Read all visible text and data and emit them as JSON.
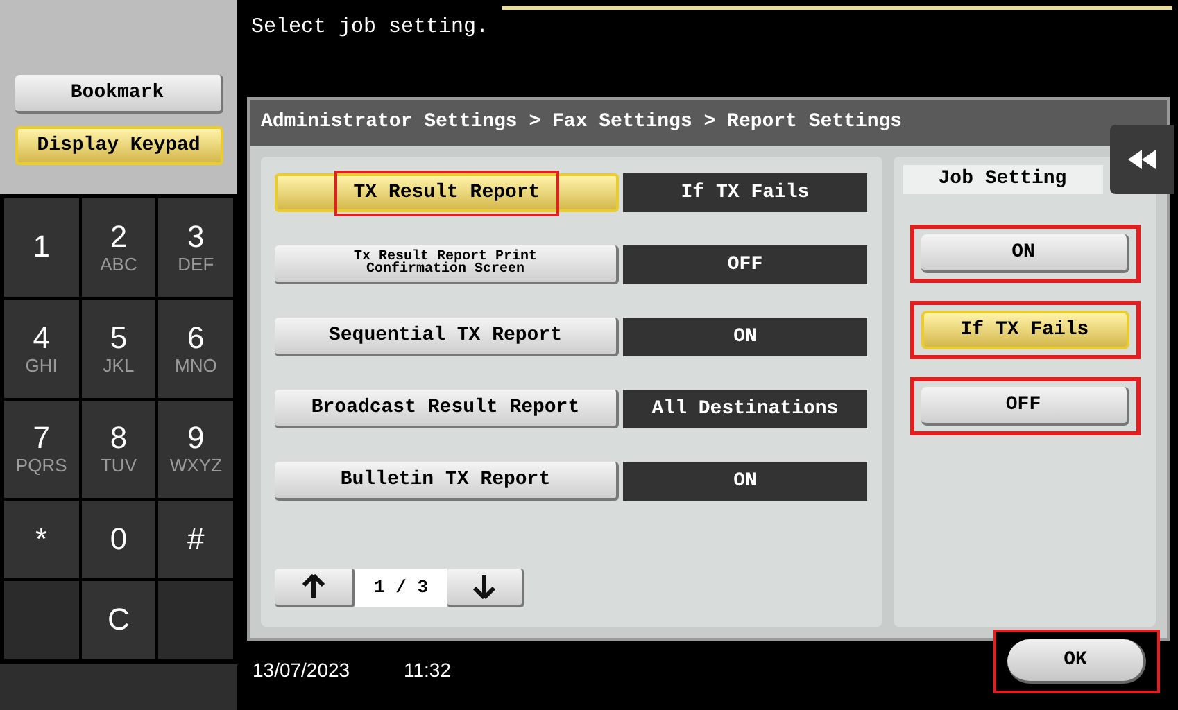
{
  "message": "Select job setting.",
  "side_buttons": [
    {
      "label": "Bookmark",
      "selected": false
    },
    {
      "label": "Display Keypad",
      "selected": true
    }
  ],
  "keypad": [
    {
      "kind": "key",
      "digit": "1"
    },
    {
      "kind": "key",
      "digit": "2",
      "letters": "ABC"
    },
    {
      "kind": "key",
      "digit": "3",
      "letters": "DEF"
    },
    {
      "kind": "key",
      "digit": "4",
      "letters": "GHI"
    },
    {
      "kind": "key",
      "digit": "5",
      "letters": "JKL"
    },
    {
      "kind": "key",
      "digit": "6",
      "letters": "MNO"
    },
    {
      "kind": "key",
      "digit": "7",
      "letters": "PQRS"
    },
    {
      "kind": "key",
      "digit": "8",
      "letters": "TUV"
    },
    {
      "kind": "key",
      "digit": "9",
      "letters": "WXYZ"
    },
    {
      "kind": "key",
      "digit": "*"
    },
    {
      "kind": "key",
      "digit": "0"
    },
    {
      "kind": "key",
      "digit": "#"
    },
    {
      "kind": "blank"
    },
    {
      "kind": "key",
      "digit": "C"
    },
    {
      "kind": "blank"
    }
  ],
  "dialog": {
    "breadcrumb": "Administrator Settings > Fax Settings > Report Settings",
    "settings": [
      {
        "kind": "normal",
        "label": "TX Result Report",
        "value": "If TX Fails",
        "selected": true,
        "highlighted": true
      },
      {
        "kind": "compact",
        "label": "Tx Result Report Print Confirmation Screen",
        "value": "OFF",
        "selected": false,
        "highlighted": false
      },
      {
        "kind": "normal",
        "label": "Sequential TX Report",
        "value": "ON",
        "selected": false,
        "highlighted": false
      },
      {
        "kind": "normal",
        "label": "Broadcast Result Report",
        "value": "All Destinations",
        "selected": false,
        "highlighted": false
      },
      {
        "kind": "normal",
        "label": "Bulletin TX Report",
        "value": "ON",
        "selected": false,
        "highlighted": false
      }
    ],
    "pager": {
      "page": "1 / 3"
    },
    "job_setting": {
      "title": "Job Setting",
      "options": [
        {
          "label": "ON",
          "selected": false,
          "highlighted": true
        },
        {
          "label": "If TX Fails",
          "selected": true,
          "highlighted": true
        },
        {
          "label": "OFF",
          "selected": false,
          "highlighted": true
        }
      ]
    }
  },
  "footer": {
    "date": "13/07/2023",
    "time": "11:32"
  },
  "ok_button": {
    "label": "OK",
    "highlighted": true
  }
}
